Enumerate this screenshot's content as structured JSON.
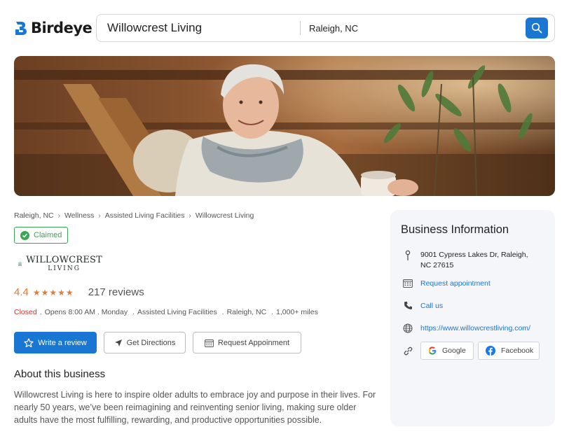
{
  "header": {
    "brand": "Birdeye",
    "search_query": "Willowcrest Living",
    "search_location": "Raleigh, NC"
  },
  "breadcrumb": [
    "Raleigh, NC",
    "Wellness",
    "Assisted Living Facilities",
    "Willowcrest Living"
  ],
  "business": {
    "claimed_label": "Claimed",
    "logo_line1": "WILLOWCREST",
    "logo_line2": "LIVING",
    "rating": "4.4",
    "stars": 4.4,
    "review_count": "217 reviews",
    "status": "Closed",
    "hours": "Opens 8:00 AM . Monday",
    "category": "Assisted Living Facilities",
    "location": "Raleigh, NC",
    "distance": "1,000+ miles"
  },
  "actions": {
    "write_review": "Write a review",
    "get_directions": "Get Directions",
    "request_appointment": "Request Appoinment"
  },
  "about": {
    "title": "About this business",
    "text": "Willowcrest Living is here to inspire older adults to embrace joy and purpose in their lives. For nearly 50 years, we’ve been reimagining and reinventing senior living, making sure older adults have the most fulfilling, rewarding, and productive opportunities possible."
  },
  "info_panel": {
    "title": "Business Information",
    "address": "9001 Cypress Lakes Dr, Raleigh, NC 27615",
    "appointment": "Request appointment",
    "call": "Call us",
    "website": "https://www.willowcrestliving.com/",
    "google": "Google",
    "facebook": "Facebook"
  },
  "colors": {
    "accent": "#1976d2",
    "rating": "#e07b39",
    "claimed": "#3aa655",
    "closed": "#d32f2f"
  }
}
